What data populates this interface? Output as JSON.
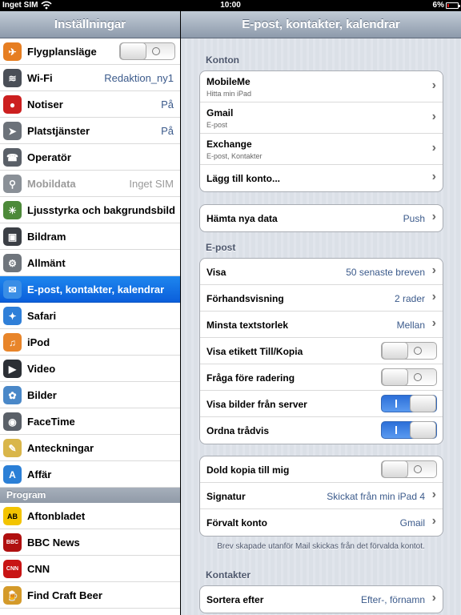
{
  "status_bar": {
    "carrier": "Inget SIM",
    "time": "10:00",
    "battery": "6%",
    "battery_level": 0.06
  },
  "left": {
    "title": "Inställningar",
    "items": [
      {
        "label": "Flygplansläge",
        "icon": "airplane-icon",
        "color": "#e67e22",
        "toggle": "off"
      },
      {
        "label": "Wi-Fi",
        "icon": "wifi-icon",
        "color": "#4a4f57",
        "value": "Redaktion_ny1"
      },
      {
        "label": "Notiser",
        "icon": "notifications-icon",
        "color": "#cc1f1f",
        "value": "På"
      },
      {
        "label": "Platstjänster",
        "icon": "location-icon",
        "color": "#6c727a",
        "value": "På"
      },
      {
        "label": "Operatör",
        "icon": "phone-icon",
        "color": "#5a6068"
      },
      {
        "label": "Mobildata",
        "icon": "cellular-icon",
        "color": "#8a9097",
        "value": "Inget SIM",
        "disabled": true
      },
      {
        "label": "Ljusstyrka och bakgrundsbild",
        "icon": "brightness-icon",
        "color": "#4d8a3a"
      },
      {
        "label": "Bildram",
        "icon": "picture-frame-icon",
        "color": "#3b3f45"
      },
      {
        "label": "Allmänt",
        "icon": "gear-icon",
        "color": "#6f757c"
      },
      {
        "label": "E-post, kontakter, kalendrar",
        "icon": "mail-icon",
        "color": "#3a8ee6",
        "selected": true
      },
      {
        "label": "Safari",
        "icon": "safari-icon",
        "color": "#2f7fd8"
      },
      {
        "label": "iPod",
        "icon": "ipod-icon",
        "color": "#e8852a"
      },
      {
        "label": "Video",
        "icon": "video-icon",
        "color": "#2b2f35"
      },
      {
        "label": "Bilder",
        "icon": "photos-icon",
        "color": "#4a88c8"
      },
      {
        "label": "FaceTime",
        "icon": "facetime-icon",
        "color": "#5a6068"
      },
      {
        "label": "Anteckningar",
        "icon": "notes-icon",
        "color": "#d9b64a"
      },
      {
        "label": "Affär",
        "icon": "appstore-icon",
        "color": "#2b7fd6"
      }
    ],
    "section_program": "Program",
    "apps": [
      {
        "label": "Aftonbladet",
        "icon": "aftonbladet-icon",
        "color": "#f3c400",
        "short": "AB"
      },
      {
        "label": "BBC News",
        "icon": "bbc-news-icon",
        "color": "#b01010",
        "short": "BBC"
      },
      {
        "label": "CNN",
        "icon": "cnn-icon",
        "color": "#c81414",
        "short": "CNN"
      },
      {
        "label": "Find Craft Beer",
        "icon": "beer-icon",
        "color": "#d49a2a"
      }
    ]
  },
  "right": {
    "title": "E-post, kontakter, kalendrar",
    "accounts": {
      "header": "Konton",
      "items": [
        {
          "label": "MobileMe",
          "sub": "Hitta min iPad"
        },
        {
          "label": "Gmail",
          "sub": "E-post"
        },
        {
          "label": "Exchange",
          "sub": "E-post, Kontakter"
        },
        {
          "label": "Lägg till konto..."
        }
      ]
    },
    "fetch": {
      "label": "Hämta nya data",
      "value": "Push"
    },
    "mail": {
      "header": "E-post",
      "items": [
        {
          "label": "Visa",
          "value": "50 senaste breven"
        },
        {
          "label": "Förhandsvisning",
          "value": "2 rader"
        },
        {
          "label": "Minsta textstorlek",
          "value": "Mellan"
        },
        {
          "label": "Visa etikett Till/Kopia",
          "toggle": "off"
        },
        {
          "label": "Fråga före radering",
          "toggle": "off"
        },
        {
          "label": "Visa bilder från server",
          "toggle": "on"
        },
        {
          "label": "Ordna trådvis",
          "toggle": "on"
        }
      ]
    },
    "compose": {
      "items": [
        {
          "label": "Dold kopia till mig",
          "toggle": "off"
        },
        {
          "label": "Signatur",
          "value": "Skickat från min iPad 4"
        },
        {
          "label": "Förvalt konto",
          "value": "Gmail"
        }
      ],
      "note": "Brev skapade utanför Mail skickas från det förvalda kontot."
    },
    "contacts": {
      "header": "Kontakter",
      "items": [
        {
          "label": "Sortera efter",
          "value": "Efter-, förnamn"
        }
      ]
    }
  }
}
